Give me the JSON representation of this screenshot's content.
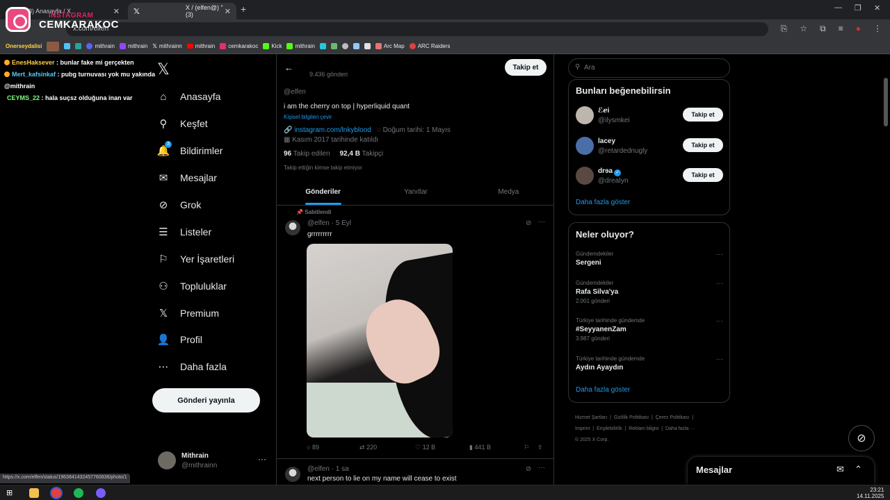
{
  "browser": {
    "tabs": [
      {
        "label": "(3) Anasayfa / X",
        "active": false
      },
      {
        "label": "X / (elfen@) \"(3)",
        "active": true
      }
    ],
    "new_tab": "+",
    "address": "x.com/elfen",
    "status_url": "https://x.com/elfen/status/1963841432457760836/photo/1",
    "bookmarks": [
      {
        "label": "mithrain",
        "icon": "discord-icon",
        "color": "#5865f2"
      },
      {
        "label": "mithrain",
        "icon": "twitch-icon",
        "color": "#9146ff"
      },
      {
        "label": "mithrainn",
        "icon": "x-icon",
        "color": "#ffffff"
      },
      {
        "label": "mithrain",
        "icon": "youtube-icon",
        "color": "#ff0000"
      },
      {
        "label": "cemkarakoc",
        "icon": "instagram-icon",
        "color": "#e1306c"
      },
      {
        "label": "Kick",
        "icon": "kick-icon",
        "color": "#53fc18"
      },
      {
        "label": "mithrain",
        "icon": "kick-icon",
        "color": "#53fc18"
      },
      {
        "label": "Arc Map",
        "icon": "map-icon",
        "color": "#8ab4f8"
      },
      {
        "label": "ARC Raiders",
        "icon": "arc-icon",
        "color": "#e04040"
      }
    ],
    "bookmark_left_label": "Onerseydalisi"
  },
  "overlay": {
    "brand_top": "INSTAGRAM",
    "brand_name": "CEMKARAKOC"
  },
  "chat": [
    {
      "user": "EnesHaksever",
      "text": "bunlar fake mi gerçekten"
    },
    {
      "user": "Mert_kafsinkaf",
      "text": "pubg turnuvası yok mu yakında @mithrain"
    },
    {
      "user": "CEYMS_22",
      "text": "hala suçsz olduğuna inan var"
    }
  ],
  "nav": {
    "items": [
      {
        "label": "Anasayfa",
        "icon": "home-icon",
        "glyph": "⌂"
      },
      {
        "label": "Keşfet",
        "icon": "search-icon",
        "glyph": "⚲"
      },
      {
        "label": "Bildirimler",
        "icon": "bell-icon",
        "glyph": "🔔",
        "badge": "3"
      },
      {
        "label": "Mesajlar",
        "icon": "mail-icon",
        "glyph": "✉"
      },
      {
        "label": "Grok",
        "icon": "grok-icon",
        "glyph": "⊘"
      },
      {
        "label": "Listeler",
        "icon": "list-icon",
        "glyph": "☰"
      },
      {
        "label": "Yer İşaretleri",
        "icon": "bookmark-icon",
        "glyph": "⚐"
      },
      {
        "label": "Topluluklar",
        "icon": "communities-icon",
        "glyph": "⚇"
      },
      {
        "label": "Premium",
        "icon": "x-icon",
        "glyph": "𝕏"
      },
      {
        "label": "Profil",
        "icon": "profile-icon",
        "glyph": "👤"
      },
      {
        "label": "Daha fazla",
        "icon": "more-circle-icon",
        "glyph": "⋯"
      }
    ],
    "post_button": "Gönderi yayınla",
    "account": {
      "name": "Mithrain",
      "handle": "@mithrainn"
    }
  },
  "profile": {
    "post_count": "9.436 gönderi",
    "follow_label": "Takip et",
    "handle": "@elfen",
    "bio": "i am the cherry on top | hyperliquid quant",
    "translate": "Kişisel bilgileri çevir",
    "link": "instagram.com/lnkyblood",
    "birthday": "Doğum tarihi: 1 Mayıs",
    "joined": "Kasım 2017 tarihinde katıldı",
    "following_count": "96",
    "following_label": "Takip edilen",
    "followers_count": "92,4 B",
    "followers_label": "Takipçi",
    "not_followed": "Takip ettiğin kimse takip etmiyor",
    "tabs": [
      "Gönderiler",
      "Yanıtlar",
      "Medya"
    ]
  },
  "tweets": [
    {
      "pinned": "Sabitlendi",
      "handle": "@elfen · 5 Eyl",
      "text": "grrrrrrrrr",
      "replies": "89",
      "reposts": "220",
      "likes": "12 B",
      "views": "441 B"
    },
    {
      "handle": "@elfen · 1 sa",
      "text": "next person to lie on my name will cease to exist"
    }
  ],
  "right": {
    "search_placeholder": "Ara",
    "who_to_follow_title": "Bunları beğenebilirsin",
    "suggestions": [
      {
        "name": "ℰℯi",
        "handle": "@ilysmkei",
        "button": "Takip et",
        "verified": false,
        "avatar_color": "#bdb6ac"
      },
      {
        "name": "lacey",
        "handle": "@retardednugly",
        "button": "Takip et",
        "verified": false,
        "avatar_color": "#4a6fa8"
      },
      {
        "name": "drɘa",
        "handle": "@dreaIyn",
        "button": "Takip et",
        "verified": true,
        "avatar_color": "#5a4842"
      }
    ],
    "show_more": "Daha fazla göster",
    "trends_title": "Neler oluyor?",
    "trends": [
      {
        "context": "Gündemdekiler",
        "title": "Sergeni",
        "count": ""
      },
      {
        "context": "Gündemdekiler",
        "title": "Rafa Silva'ya",
        "count": "2.001 gönderi"
      },
      {
        "context": "Türkiye tarihinde gündemde",
        "title": "#SeyyanenZam",
        "count": "3.987 gönderi"
      },
      {
        "context": "Türkiye tarihinde gündemde",
        "title": "Aydın Ayaydın",
        "count": ""
      }
    ],
    "trends_show_more": "Daha fazla göster",
    "footer": [
      "Hizmet Şartları",
      "Gizlilik Politikası",
      "Çerez Politikası",
      "Imprint",
      "Erişilebilirlik",
      "Reklam bilgisi",
      "Daha fazla ···",
      "© 2025 X Corp."
    ]
  },
  "messages_dock": {
    "title": "Mesajlar"
  },
  "taskbar": {
    "time": "23:21",
    "date": "14.11.2025"
  },
  "colors": {
    "accent": "#1d9bf0",
    "background": "#000000",
    "border": "#2f3336",
    "muted": "#71767b"
  }
}
